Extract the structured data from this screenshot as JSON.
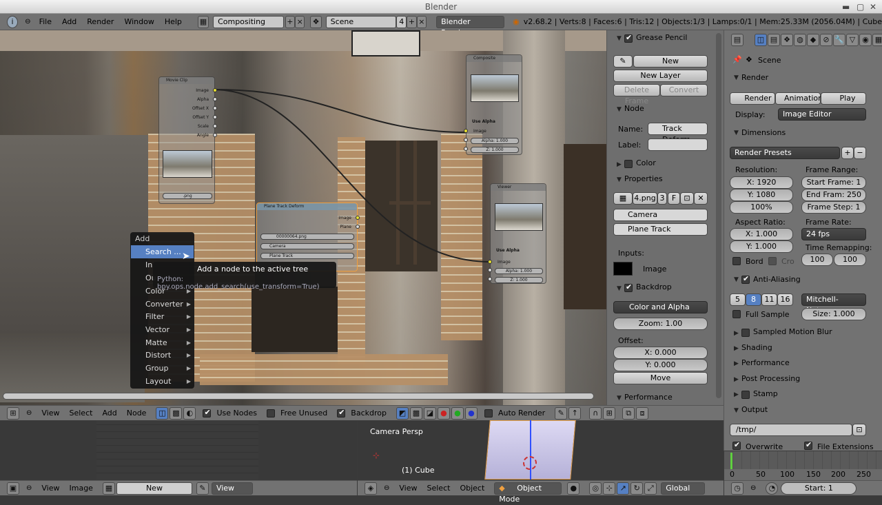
{
  "window": {
    "title": "Blender"
  },
  "info": {
    "menus": [
      "File",
      "Add",
      "Render",
      "Window",
      "Help"
    ],
    "screen": "Compositing",
    "scene": "Scene",
    "scene_users": "4",
    "engine": "Blender Render",
    "stats": "v2.68.2 | Verts:8 | Faces:6 | Tris:12 | Objects:1/3 | Lamps:0/1 | Mem:25.33M (2056.04M) | Cube"
  },
  "nodes": {
    "movieclip": {
      "title": "Movie Clip",
      "outputs": [
        "Image",
        "Alpha",
        "Offset X",
        "Offset Y",
        "Scale",
        "Angle"
      ],
      "file": ".png"
    },
    "composite": {
      "title": "Composite",
      "use_alpha": "Use Alpha",
      "input": "Image",
      "alpha": "Alpha: 1.000",
      "z": "Z: 1.000"
    },
    "viewer": {
      "title": "Viewer",
      "use_alpha": "Use Alpha",
      "input": "Image",
      "alpha": "Alpha: 1.000",
      "z": "Z: 1.000"
    },
    "planetrack": {
      "title": "Plane Track Deform",
      "outputs": [
        "Image",
        "Plane"
      ],
      "file": "00000064.png",
      "camera": "Camera",
      "track": "Plane Track"
    }
  },
  "add_menu": {
    "title": "Add",
    "items": [
      "Search ...",
      "In",
      "Ou",
      "Color",
      "Converter",
      "Filter",
      "Vector",
      "Matte",
      "Distort",
      "Group",
      "Layout"
    ]
  },
  "tooltip": {
    "text": "Add a node to the active tree",
    "python": "Python: bpy.ops.node.add_search(use_transform=True)"
  },
  "node_editor_toolbar": {
    "items": [
      "View",
      "Select",
      "Add",
      "Node"
    ],
    "use_nodes": "Use Nodes",
    "free_unused": "Free Unused",
    "backdrop": "Backdrop",
    "auto_render": "Auto Render"
  },
  "npanel": {
    "grease_pencil": {
      "title": "Grease Pencil",
      "new": "New",
      "new_layer": "New Layer",
      "delete_frame": "Delete Frame",
      "convert": "Convert"
    },
    "node": {
      "title": "Node",
      "name_label": "Name:",
      "name": "Track Deform",
      "label_label": "Label:"
    },
    "color": {
      "title": "Color"
    },
    "properties": {
      "title": "Properties",
      "image": "4.png",
      "users": "3",
      "f": "F",
      "camera": "Camera",
      "track": "Plane Track",
      "inputs": "Inputs:",
      "image_input": "Image"
    },
    "backdrop": {
      "title": "Backdrop",
      "channels": "Color and Alpha",
      "zoom": "Zoom: 1.00",
      "offset": "Offset:",
      "x": "X: 0.000",
      "y": "Y: 0.000",
      "move": "Move"
    },
    "performance": {
      "title": "Performance"
    }
  },
  "props": {
    "context": "Scene",
    "render": {
      "title": "Render",
      "render": "Render",
      "animation": "Animation",
      "play": "Play",
      "display_label": "Display:",
      "display": "Image Editor"
    },
    "dimensions": {
      "title": "Dimensions",
      "presets": "Render Presets",
      "resolution": "Resolution:",
      "x": "X: 1920",
      "y": "Y: 1080",
      "pct": "100%",
      "frame_range": "Frame Range:",
      "start": "Start Frame: 1",
      "end": "End Fram: 250",
      "step": "Frame Step: 1",
      "aspect": "Aspect Ratio:",
      "ax": "X: 1.000",
      "ay": "Y: 1.000",
      "frame_rate": "Frame Rate:",
      "fps": "24 fps",
      "remap": "Time Remapping:",
      "old": "100",
      "new": "100",
      "bord": "Bord",
      "crop": "Cro"
    },
    "aa": {
      "title": "Anti-Aliasing",
      "samples": [
        "5",
        "8",
        "11",
        "16"
      ],
      "filter": "Mitchell-Netrava",
      "full": "Full Sample",
      "size": "Size: 1.000"
    },
    "collapsed": [
      "Sampled Motion Blur",
      "Shading",
      "Performance",
      "Post Processing",
      "Stamp"
    ],
    "output": {
      "title": "Output",
      "path": "/tmp/",
      "overwrite": "Overwrite",
      "extensions": "File Extensions"
    }
  },
  "viewport": {
    "label": "Camera Persp",
    "object": "(1) Cube",
    "menus": [
      "View",
      "Select",
      "Object"
    ],
    "mode": "Object Mode",
    "orientation": "Global"
  },
  "image_editor": {
    "menus": [
      "View",
      "Image"
    ],
    "new": "New",
    "view": "View"
  },
  "timeline": {
    "ticks": [
      "0",
      "50",
      "100",
      "150",
      "200",
      "250"
    ],
    "start": "Start: 1"
  }
}
